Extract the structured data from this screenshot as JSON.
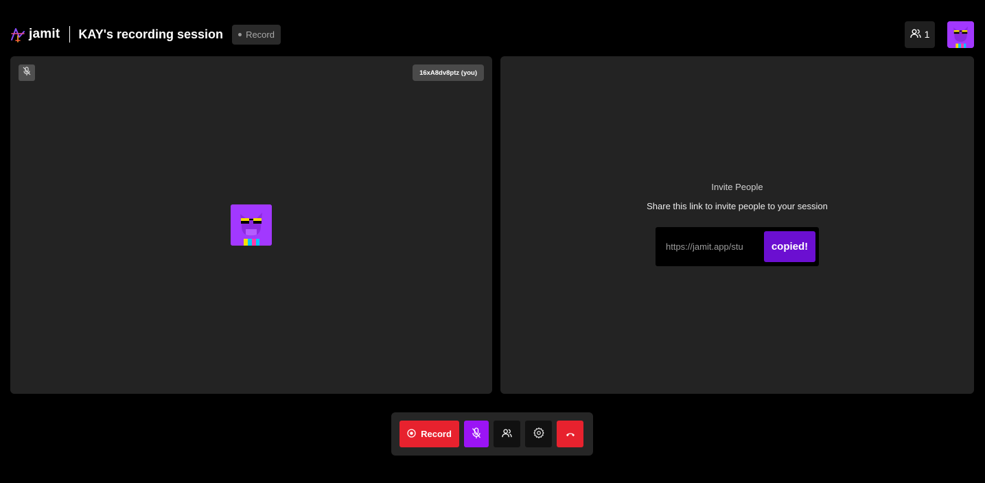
{
  "header": {
    "brand_name": "jamit",
    "session_title": "KAY's recording session",
    "record_badge": "Record",
    "participant_count": "1"
  },
  "video": {
    "name_tag": "16xA8dv8ptz (you)"
  },
  "invite": {
    "title": "Invite People",
    "subtitle": "Share this link to invite people to your session",
    "link": "https://jamit.app/stu",
    "copy_button": "copied!"
  },
  "controls": {
    "record_label": "Record"
  },
  "colors": {
    "accent_purple": "#9b14f5",
    "danger_red": "#e7222e",
    "copy_purple": "#6b0fd1",
    "panel_bg": "#232323"
  },
  "icons": [
    "logo-icon",
    "users-icon",
    "avatar-icon",
    "mic-off-icon",
    "record-icon",
    "gear-icon",
    "phone-hangup-icon"
  ]
}
